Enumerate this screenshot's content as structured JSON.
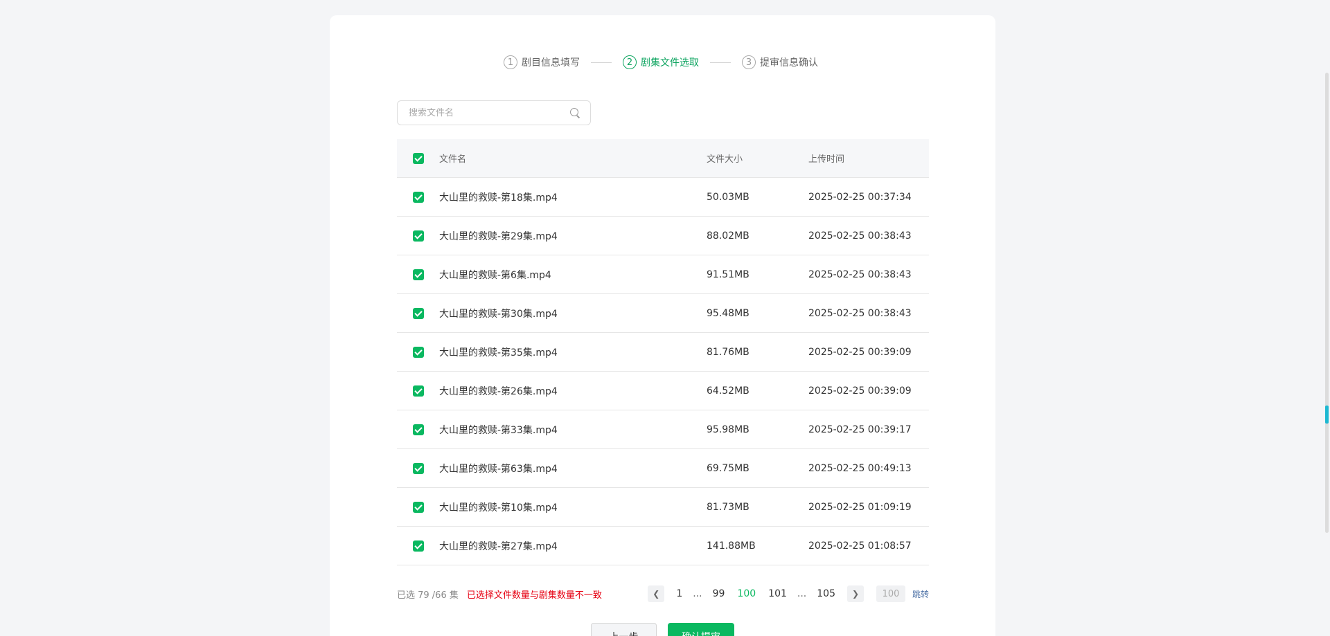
{
  "steps": [
    {
      "num": "1",
      "label": "剧目信息填写"
    },
    {
      "num": "2",
      "label": "剧集文件选取"
    },
    {
      "num": "3",
      "label": "提审信息确认"
    }
  ],
  "search": {
    "placeholder": "搜索文件名"
  },
  "table": {
    "headers": {
      "name": "文件名",
      "size": "文件大小",
      "time": "上传时间"
    },
    "rows": [
      {
        "name": "大山里的救赎-第18集.mp4",
        "size": "50.03MB",
        "time": "2025-02-25 00:37:34"
      },
      {
        "name": "大山里的救赎-第29集.mp4",
        "size": "88.02MB",
        "time": "2025-02-25 00:38:43"
      },
      {
        "name": "大山里的救赎-第6集.mp4",
        "size": "91.51MB",
        "time": "2025-02-25 00:38:43"
      },
      {
        "name": "大山里的救赎-第30集.mp4",
        "size": "95.48MB",
        "time": "2025-02-25 00:38:43"
      },
      {
        "name": "大山里的救赎-第35集.mp4",
        "size": "81.76MB",
        "time": "2025-02-25 00:39:09"
      },
      {
        "name": "大山里的救赎-第26集.mp4",
        "size": "64.52MB",
        "time": "2025-02-25 00:39:09"
      },
      {
        "name": "大山里的救赎-第33集.mp4",
        "size": "95.98MB",
        "time": "2025-02-25 00:39:17"
      },
      {
        "name": "大山里的救赎-第63集.mp4",
        "size": "69.75MB",
        "time": "2025-02-25 00:49:13"
      },
      {
        "name": "大山里的救赎-第10集.mp4",
        "size": "81.73MB",
        "time": "2025-02-25 01:09:19"
      },
      {
        "name": "大山里的救赎-第27集.mp4",
        "size": "141.88MB",
        "time": "2025-02-25 01:08:57"
      }
    ]
  },
  "footer": {
    "selected": "已选 79 /66 集",
    "warning": "已选择文件数量与剧集数量不一致"
  },
  "pagination": {
    "first": "1",
    "dots": "...",
    "prev_page": "99",
    "current": "100",
    "next_page": "101",
    "last": "105",
    "jump_placeholder": "100",
    "jump_label": "跳转"
  },
  "actions": {
    "prev": "上一步",
    "submit": "确认提审"
  },
  "colors": {
    "accent": "#0ab860",
    "warning": "#e60012"
  }
}
